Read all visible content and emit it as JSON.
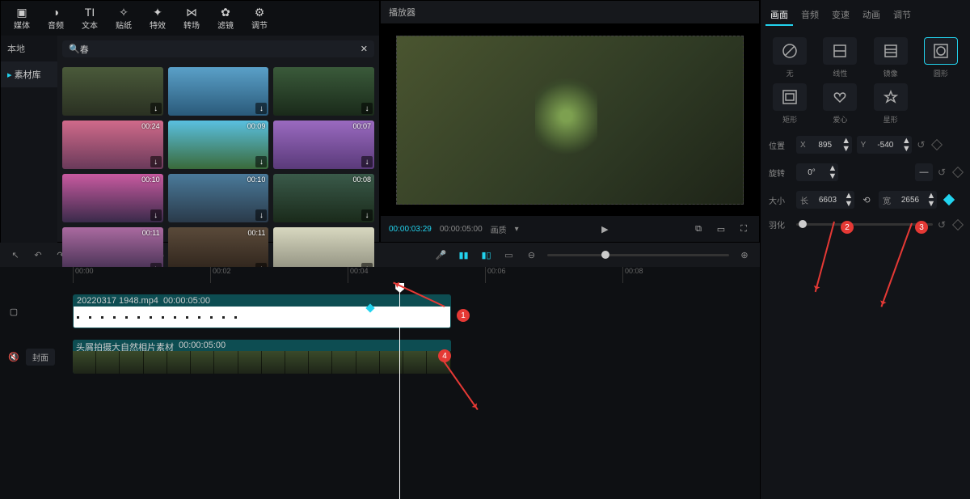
{
  "topnav": [
    {
      "icon": "▣",
      "label": "媒体",
      "active": true
    },
    {
      "icon": "◑",
      "label": "音频"
    },
    {
      "icon": "TI",
      "label": "文本"
    },
    {
      "icon": "✧",
      "label": "贴纸"
    },
    {
      "icon": "✦",
      "label": "特效"
    },
    {
      "icon": "⋈",
      "label": "转场"
    },
    {
      "icon": "✿",
      "label": "滤镜"
    },
    {
      "icon": "⚙",
      "label": "调节"
    }
  ],
  "side": {
    "local": "本地",
    "library": "素材库"
  },
  "search": {
    "placeholder": "春",
    "clear": "✕"
  },
  "thumbs": [
    {
      "dur": "",
      "bg": "linear-gradient(#4a5a3a,#2a3022)"
    },
    {
      "dur": "",
      "bg": "linear-gradient(#5aa0c8,#2a5a7a)"
    },
    {
      "dur": "",
      "bg": "linear-gradient(#3a5a3a,#1a2a1a)"
    },
    {
      "dur": "00:24",
      "bg": "linear-gradient(#d06a8a,#6a3a5a)"
    },
    {
      "dur": "00:09",
      "bg": "linear-gradient(#5ac0e0,#3a6a3a)"
    },
    {
      "dur": "00:07",
      "bg": "linear-gradient(#9a6ac0,#5a3a7a)"
    },
    {
      "dur": "00:10",
      "bg": "linear-gradient(#c85aa0,#3a2a4a)"
    },
    {
      "dur": "00:10",
      "bg": "linear-gradient(#4a7a9a,#2a3a4a)"
    },
    {
      "dur": "00:08",
      "bg": "linear-gradient(#3a5a4a,#1a2a1a)"
    },
    {
      "dur": "00:11",
      "bg": "linear-gradient(#aa6aa0,#3a2a4a)"
    },
    {
      "dur": "00:11",
      "bg": "linear-gradient(#5a4a3a,#2a2018)"
    },
    {
      "dur": "",
      "bg": "linear-gradient(#d8d8c0,#888878)"
    }
  ],
  "preview": {
    "title": "播放器",
    "tc": "00:00:03:29",
    "dur": "00:00:05:00",
    "ratio": "画质"
  },
  "ptabs": [
    "画面",
    "音频",
    "变速",
    "动画",
    "调节"
  ],
  "shapes": [
    {
      "name": "无",
      "sel": false
    },
    {
      "name": "线性",
      "sel": false
    },
    {
      "name": "镜像",
      "sel": false
    },
    {
      "name": "圆形",
      "sel": true
    },
    {
      "name": "矩形",
      "sel": false
    },
    {
      "name": "爱心",
      "sel": false
    },
    {
      "name": "星形",
      "sel": false
    }
  ],
  "props": {
    "position": {
      "label": "位置",
      "x_pre": "X",
      "x": "895",
      "y_pre": "Y",
      "y": "-540"
    },
    "rotation": {
      "label": "旋转",
      "val": "0°"
    },
    "size": {
      "label": "大小",
      "w_pre": "长",
      "w": "6603",
      "h_pre": "宽",
      "h": "2656"
    },
    "feather": {
      "label": "羽化"
    }
  },
  "timeline": {
    "ticks": [
      "00:00",
      "00:02",
      "00:04",
      "00:06",
      "00:08"
    ],
    "clip1": {
      "name": "20220317 1948.mp4",
      "dur": "00:00:05:00"
    },
    "clip2": {
      "name": "头屑拍摄大自然相片素材",
      "dur": "00:00:05:00"
    },
    "cover": "封面"
  },
  "ann": {
    "b1": "1",
    "b2": "2",
    "b3": "3",
    "b4": "4"
  }
}
